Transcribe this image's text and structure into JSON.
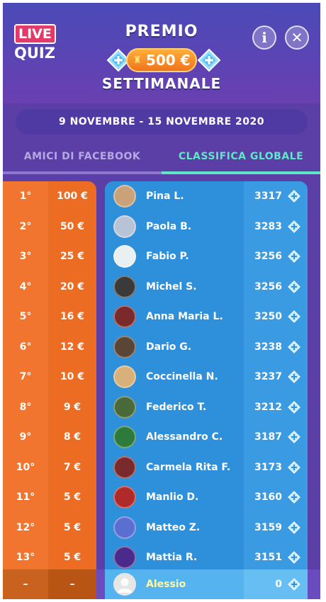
{
  "header": {
    "logo_live": "LIVE",
    "logo_quiz": "QUIZ",
    "title_top": "PREMIO",
    "title_bottom": "SETTIMANALE",
    "prize_amount": "500 €",
    "info_label": "i",
    "close_label": "✕"
  },
  "date_range": "9 NOVEMBRE - 15 NOVEMBRE 2020",
  "tabs": [
    {
      "label": "AMICI DI FACEBOOK",
      "active": false
    },
    {
      "label": "CLASSIFICA GLOBALE",
      "active": true
    }
  ],
  "prizes": [
    {
      "rank": "1°",
      "amount": "100 €"
    },
    {
      "rank": "2°",
      "amount": "50 €"
    },
    {
      "rank": "3°",
      "amount": "25 €"
    },
    {
      "rank": "4°",
      "amount": "20 €"
    },
    {
      "rank": "5°",
      "amount": "16 €"
    },
    {
      "rank": "6°",
      "amount": "12 €"
    },
    {
      "rank": "7°",
      "amount": "10 €"
    },
    {
      "rank": "8°",
      "amount": "9 €"
    },
    {
      "rank": "9°",
      "amount": "8 €"
    },
    {
      "rank": "10°",
      "amount": "7 €"
    },
    {
      "rank": "11°",
      "amount": "5 €"
    },
    {
      "rank": "12°",
      "amount": "5 €"
    },
    {
      "rank": "13°",
      "amount": "5 €"
    }
  ],
  "players": [
    {
      "name": "Pina L.",
      "score": "3317",
      "avatar_color": "#c9a27a",
      "avatar_icon": "photo-avatar"
    },
    {
      "name": "Paola B.",
      "score": "3283",
      "avatar_color": "#b8c4d6",
      "avatar_icon": "photo-avatar"
    },
    {
      "name": "Fabio P.",
      "score": "3256",
      "avatar_color": "#e8f0f2",
      "avatar_icon": "bitmoji-avatar"
    },
    {
      "name": "Michel S.",
      "score": "3256",
      "avatar_color": "#3a3a3a",
      "avatar_icon": "photo-avatar"
    },
    {
      "name": "Anna Maria L.",
      "score": "3250",
      "avatar_color": "#7a2a2a",
      "avatar_icon": "dog-avatar"
    },
    {
      "name": "Dario G.",
      "score": "3238",
      "avatar_color": "#5a4636",
      "avatar_icon": "photo-avatar"
    },
    {
      "name": "Coccinella N.",
      "score": "3237",
      "avatar_color": "#d8b07a",
      "avatar_icon": "dog-photo-avatar"
    },
    {
      "name": "Federico T.",
      "score": "3212",
      "avatar_color": "#4a6a3a",
      "avatar_icon": "photo-avatar"
    },
    {
      "name": "Alessandro C.",
      "score": "3187",
      "avatar_color": "#2e7a3a",
      "avatar_icon": "alien-avatar"
    },
    {
      "name": "Carmela Rita F.",
      "score": "3173",
      "avatar_color": "#7a2a2a",
      "avatar_icon": "dog-avatar"
    },
    {
      "name": "Manlio D.",
      "score": "3160",
      "avatar_color": "#b02a2a",
      "avatar_icon": "hamster-avatar"
    },
    {
      "name": "Matteo Z.",
      "score": "3159",
      "avatar_color": "#5b6fd0",
      "avatar_icon": "loading-avatar"
    },
    {
      "name": "Mattia R.",
      "score": "3151",
      "avatar_color": "#4a2a8a",
      "avatar_icon": "space-invader-avatar"
    }
  ],
  "current_user": {
    "rank": "–",
    "amount": "–",
    "name": "Alessio",
    "score": "0",
    "avatar_color": "#e6e6e6",
    "avatar_icon": "default-avatar"
  },
  "colors": {
    "orange": "#f1752e",
    "blue": "#2e8fdb",
    "accent_green": "#5fe8c6",
    "purple": "#5b3fa6"
  }
}
